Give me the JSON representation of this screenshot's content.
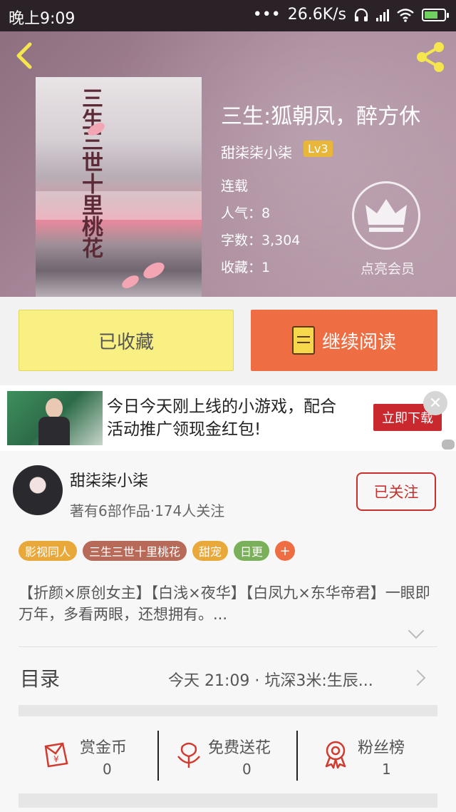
{
  "status_bar": {
    "time": "晚上9:09",
    "dots": "•••",
    "speed": "26.6K/s"
  },
  "book": {
    "title": "三生:狐朝凤，醉方休",
    "author": "甜柒柒小柒",
    "level": "Lv3",
    "status": "连载",
    "popularity": "人气：8",
    "word_count": "字数：3,304",
    "favorites": "收藏：1",
    "cover_title": "三生三世十里桃花",
    "vip_label": "点亮会员"
  },
  "actions": {
    "favorited_label": "已收藏",
    "continue_reading_label": "继续阅读"
  },
  "ad": {
    "text": "今日今天刚上线的小游戏，配合活动推广领现金红包!",
    "button_label": "立即下载",
    "close": "✕"
  },
  "author_card": {
    "name": "甜柒柒小柒",
    "info": "著有6部作品·174人关注",
    "follow_label": "已关注"
  },
  "tags": [
    {
      "label": "影视同人",
      "color": "#e9a93a"
    },
    {
      "label": "三生三世十里桃花",
      "color": "#b86a58"
    },
    {
      "label": "甜宠",
      "color": "#e9a93a"
    },
    {
      "label": "日更",
      "color": "#7ab05a"
    }
  ],
  "tag_more": "+",
  "description": "【折颜×原创女主】【白浅×夜华】【白凤九×东华帝君】一眼即万年，多看两眼，还想拥有。...",
  "toc": {
    "label": "目录",
    "latest": "今天 21:09 · 坑深3米:生辰..."
  },
  "stats": [
    {
      "label": "赏金币",
      "value": "0",
      "icon": "red-envelope-icon"
    },
    {
      "label": "免费送花",
      "value": "0",
      "icon": "flower-icon"
    },
    {
      "label": "粉丝榜",
      "value": "1",
      "icon": "medal-icon"
    }
  ]
}
